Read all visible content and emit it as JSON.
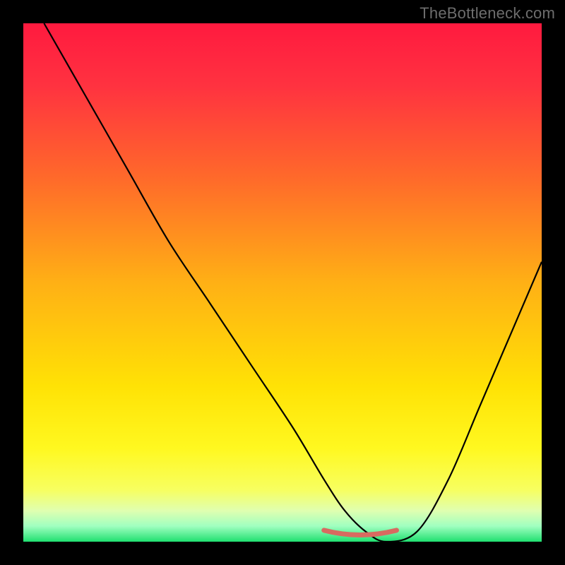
{
  "watermark": "TheBottleneck.com",
  "colors": {
    "gradient_stops": [
      {
        "offset": 0.0,
        "color": "#ff1a3f"
      },
      {
        "offset": 0.12,
        "color": "#ff3240"
      },
      {
        "offset": 0.3,
        "color": "#ff6a2a"
      },
      {
        "offset": 0.5,
        "color": "#ffb015"
      },
      {
        "offset": 0.7,
        "color": "#ffe205"
      },
      {
        "offset": 0.82,
        "color": "#fff820"
      },
      {
        "offset": 0.9,
        "color": "#f7ff60"
      },
      {
        "offset": 0.94,
        "color": "#e0ffb0"
      },
      {
        "offset": 0.97,
        "color": "#a0ffc0"
      },
      {
        "offset": 1.0,
        "color": "#20e070"
      }
    ],
    "curve_stroke": "#000000",
    "bottom_marker": "#d86a60",
    "frame": "#000000"
  },
  "chart_data": {
    "type": "line",
    "title": "",
    "xlabel": "",
    "ylabel": "",
    "xlim": [
      0,
      100
    ],
    "ylim": [
      0,
      100
    ],
    "note": "Axes are unlabeled percent scales; values estimated from pixels.",
    "series": [
      {
        "name": "bottleneck-curve",
        "x": [
          4,
          12,
          20,
          28,
          36,
          44,
          52,
          58,
          62,
          66,
          70,
          76,
          82,
          88,
          94,
          100
        ],
        "y": [
          100,
          86,
          72,
          58,
          46,
          34,
          22,
          12,
          6,
          2,
          0,
          2,
          12,
          26,
          40,
          54
        ]
      }
    ],
    "annotations": [
      {
        "name": "optimal-range-marker",
        "x_range": [
          58,
          72
        ],
        "y": 1
      }
    ]
  }
}
